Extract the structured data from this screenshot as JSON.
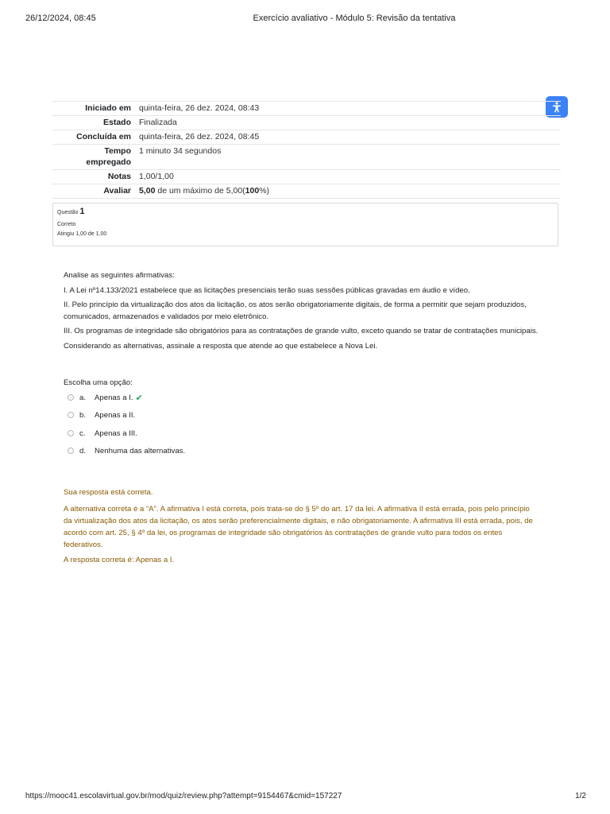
{
  "print_header": {
    "datetime": "26/12/2024, 08:45",
    "title": "Exercício avaliativo - Módulo 5: Revisão da tentativa"
  },
  "accessibility_button": {
    "icon": "accessibility-icon",
    "color": "#3b82f6"
  },
  "summary": {
    "started_label": "Iniciado em",
    "started_value": "quinta-feira, 26 dez. 2024, 08:43",
    "state_label": "Estado",
    "state_value": "Finalizada",
    "completed_label": "Concluída em",
    "completed_value": "quinta-feira, 26 dez. 2024, 08:45",
    "time_label_1": "Tempo",
    "time_label_2": "empregado",
    "time_value": "1 minuto 34 segundos",
    "marks_label": "Notas",
    "marks_value": "1,00/1,00",
    "grade_label": "Avaliar",
    "grade_score": "5,00",
    "grade_mid": " de um máximo de 5,00(",
    "grade_percent": "100",
    "grade_end": "%)"
  },
  "question_info": {
    "question_label": "Questão ",
    "question_number": "1",
    "status": "Correto",
    "mark": "Atingiu 1,00 de 1,00"
  },
  "question": {
    "intro": "Analise as seguintes afirmativas:",
    "item1": "I. A Lei nº14.133/2021 estabelece que as licitações presenciais terão suas sessões públicas gravadas em áudio e vídeo.",
    "item2": "II. Pelo princípio da virtualização dos atos da licitação, os atos serão obrigatoriamente digitais, de forma a permitir que sejam produzidos, comunicados, armazenados e validados por meio eletrônico.",
    "item3": "III. Os programas de integridade são obrigatórios para as contratações de grande vulto, exceto quando se tratar de contratações municipais.",
    "closing": "Considerando as alternativas, assinale a resposta que atende ao que estabelece a Nova Lei."
  },
  "answer": {
    "prompt": "Escolha uma opção:",
    "options": [
      {
        "letter": "a.",
        "text": "Apenas a I.",
        "selected": true,
        "correct": true
      },
      {
        "letter": "b.",
        "text": "Apenas a II.",
        "selected": false
      },
      {
        "letter": "c.",
        "text": "Apenas a III.",
        "selected": false
      },
      {
        "letter": "d.",
        "text": "Nenhuma das alternativas.",
        "selected": false
      }
    ]
  },
  "feedback": {
    "status": "Sua resposta está correta.",
    "general": "A alternativa correta é a “A”.  A afirmativa I está correta, pois trata-se do § 5º do art. 17 da lei. A afirmativa II está errada, pois pelo princípio da virtualização dos atos da licitação, os atos serão preferencialmente digitais, e não obrigatoriamente. A afirmativa III está errada, pois, de acordo com art. 25, § 4º da lei, os programas de integridade são obrigatórios às contratações de grande vulto para todos os entes federativos.",
    "right_answer": "A resposta correta é: Apenas a I.",
    "color": "#8a5a00"
  },
  "print_footer": {
    "url": "https://mooc41.escolavirtual.gov.br/mod/quiz/review.php?attempt=9154467&cmid=157227",
    "page": "1/2"
  }
}
